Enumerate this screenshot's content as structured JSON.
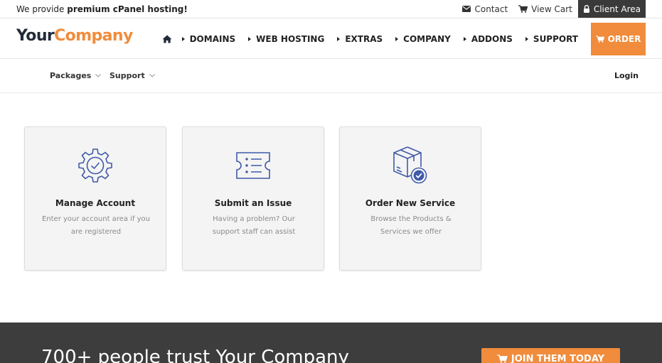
{
  "topbar": {
    "tagline_prefix": "We provide",
    "tagline_bold": "premium cPanel hosting!",
    "links": {
      "contact": "Contact",
      "view_cart": "View Cart",
      "client_area": "Client Area"
    }
  },
  "header": {
    "logo_part1": "Your",
    "logo_part2": "Company",
    "nav": {
      "domains": "DOMAINS",
      "web_hosting": "WEB HOSTING",
      "extras": "EXTRAS",
      "company": "COMPANY",
      "addons": "ADDONS",
      "support": "SUPPORT"
    },
    "order_label": "ORDER"
  },
  "subnav": {
    "packages": "Packages",
    "support": "Support",
    "login": "Login"
  },
  "cards": [
    {
      "icon": "gear-check-icon",
      "title": "Manage Account",
      "desc": "Enter your account area if you are registered"
    },
    {
      "icon": "ticket-icon",
      "title": "Submit an Issue",
      "desc": "Having a problem? Our support staff can assist"
    },
    {
      "icon": "box-check-icon",
      "title": "Order New Service",
      "desc": "Browse the Products & Services we offer"
    }
  ],
  "band": {
    "headline": "700+ people trust Your Company",
    "cta": "JOIN THEM TODAY"
  },
  "colors": {
    "accent": "#f08c3c",
    "dark": "#3d3d3d",
    "icon_blue": "#3f5aa8"
  }
}
